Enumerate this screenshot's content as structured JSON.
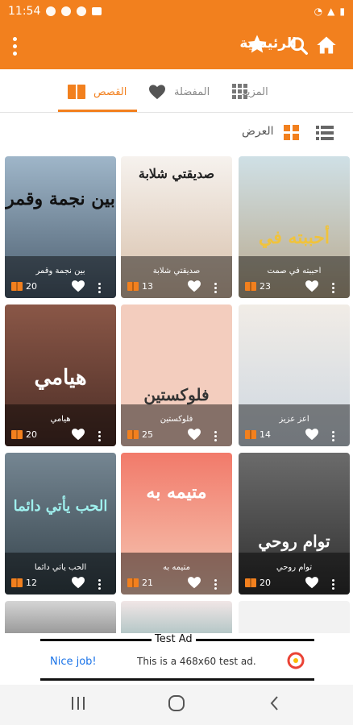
{
  "status": {
    "time": "11:54"
  },
  "appbar": {
    "title": "الرئيسية"
  },
  "tabs": [
    {
      "label": "القصص",
      "active": true
    },
    {
      "label": "المفضلة",
      "active": false
    },
    {
      "label": "المزيد",
      "active": false
    }
  ],
  "view": {
    "label": "العرض"
  },
  "cards": [
    {
      "title": "أحببته في صمت",
      "count": "23",
      "cover_text": "أحببته في",
      "bg": "#d8d2c3"
    },
    {
      "title": "صديقتي شلابة",
      "count": "13",
      "cover_text": "صديقتي شلابة",
      "bg": "#efe7df"
    },
    {
      "title": "بين نجمة وقمر",
      "count": "20",
      "cover_text": "بين نجمة وقمر",
      "bg": "#6d7f92"
    },
    {
      "title": "أعز عزيز",
      "count": "14",
      "cover_text": "",
      "bg": "#e9e3dd"
    },
    {
      "title": "فلوكستين",
      "count": "25",
      "cover_text": "فلوكستين",
      "bg": "#f2cfc2"
    },
    {
      "title": "هيامي",
      "count": "20",
      "cover_text": "هيامي",
      "bg": "#7a4a3c"
    },
    {
      "title": "توام روحي",
      "count": "20",
      "cover_text": "توام روحي",
      "bg": "#4b4b4b"
    },
    {
      "title": "متيمه به",
      "count": "21",
      "cover_text": "متيمه به",
      "bg": "#f27a6a"
    },
    {
      "title": "الحب يأتي دائما",
      "count": "12",
      "cover_text": "الحب يأتي دائما",
      "bg": "#5b6e77"
    }
  ],
  "ad": {
    "label": "Test Ad",
    "nice": "Nice job!",
    "desc": "This is a 468x60 test ad."
  },
  "colors": {
    "primary": "#f2801e"
  }
}
